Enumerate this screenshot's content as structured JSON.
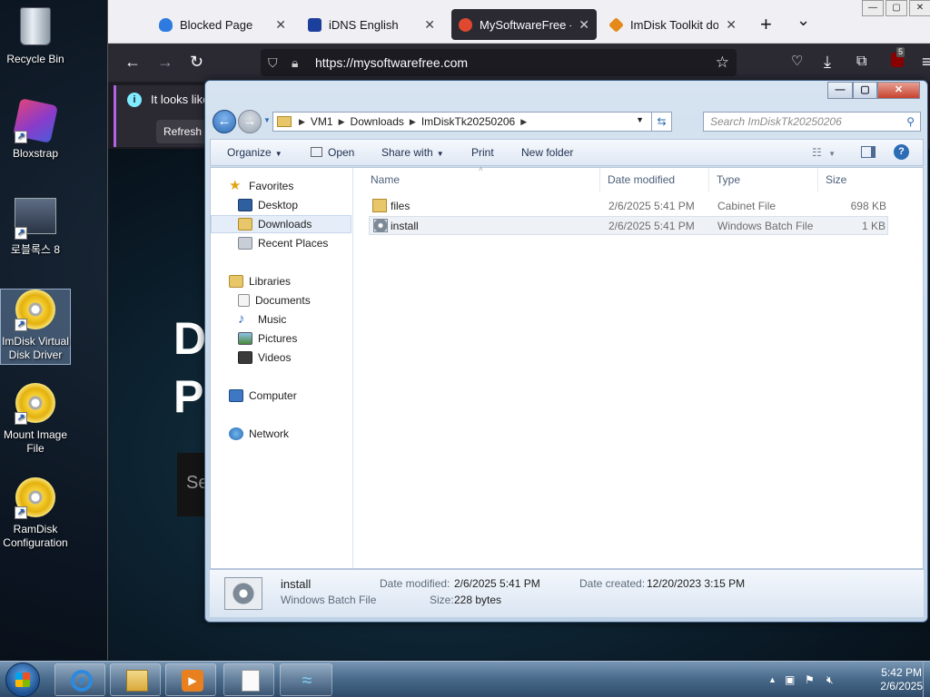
{
  "desktop": {
    "icons": [
      {
        "label": "Recycle Bin",
        "icon": "recycle-bin-icon"
      },
      {
        "label": "Bloxstrap",
        "icon": "bloxstrap-icon"
      },
      {
        "label": "로블록스 8",
        "icon": "roblox-avatar-icon"
      },
      {
        "label": "ImDisk Virtual Disk Driver",
        "icon": "disc-icon"
      },
      {
        "label": "Mount Image File",
        "icon": "disc-icon"
      },
      {
        "label": "RamDisk Configuration",
        "icon": "disc-icon"
      }
    ]
  },
  "browser": {
    "tabs": [
      {
        "label": "Blocked Page",
        "icon": "shield-icon",
        "color": "#2e7be0"
      },
      {
        "label": "iDNS English",
        "icon": "idns-icon",
        "color": "#1d3f9c"
      },
      {
        "label": "MySoftwareFree - D",
        "icon": "mysoftwarefree-icon",
        "color": "#e0482f"
      },
      {
        "label": "ImDisk Toolkit dowr",
        "icon": "imdisk-icon",
        "color": "#e58a1a"
      }
    ],
    "new_tab": "+",
    "list_tabs": "⌄",
    "url": "https://mysoftwarefree.com",
    "extension_badge": "5",
    "notice_text": "It looks like",
    "notice_button": "Refresh F",
    "page_hero_1": "D",
    "page_hero_2": "P",
    "page_search": "Se"
  },
  "explorer": {
    "breadcrumb": [
      "VM1",
      "Downloads",
      "ImDiskTk20250206"
    ],
    "search_placeholder": "Search ImDiskTk20250206",
    "commands": {
      "organize": "Organize",
      "open": "Open",
      "share_with": "Share with",
      "print": "Print",
      "new_folder": "New folder"
    },
    "nav": {
      "favorites": "Favorites",
      "desktop": "Desktop",
      "downloads": "Downloads",
      "recent_places": "Recent Places",
      "libraries": "Libraries",
      "documents": "Documents",
      "music": "Music",
      "pictures": "Pictures",
      "videos": "Videos",
      "computer": "Computer",
      "network": "Network"
    },
    "columns": {
      "name": "Name",
      "date_modified": "Date modified",
      "type": "Type",
      "size": "Size"
    },
    "files": [
      {
        "name": "files",
        "date": "2/6/2025 5:41 PM",
        "type": "Cabinet File",
        "size": "698 KB",
        "icon": "folder-icon"
      },
      {
        "name": "install",
        "date": "2/6/2025 5:41 PM",
        "type": "Windows Batch File",
        "size": "1 KB",
        "icon": "batch-file-icon"
      }
    ],
    "details": {
      "name": "install",
      "type": "Windows Batch File",
      "date_modified_label": "Date modified:",
      "date_modified": "2/6/2025 5:41 PM",
      "size_label": "Size:",
      "size": "228 bytes",
      "date_created_label": "Date created:",
      "date_created": "12/20/2023 3:15 PM"
    }
  },
  "taskbar": {
    "clock_time": "5:42 PM",
    "clock_date": "2/6/2025",
    "tray_expand": "▲"
  }
}
